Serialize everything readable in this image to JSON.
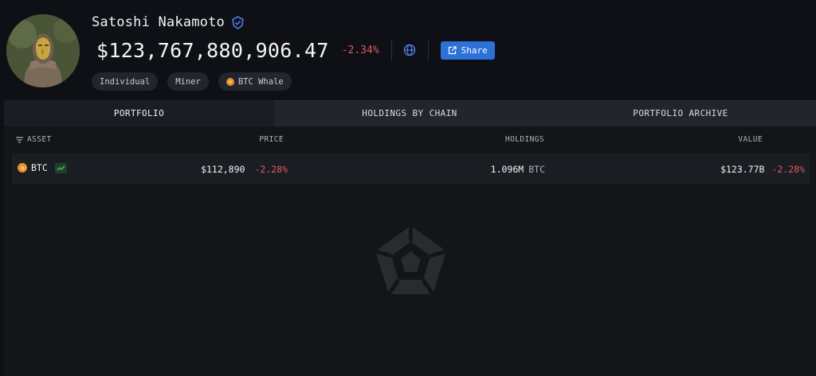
{
  "profile": {
    "name": "Satoshi Nakamoto",
    "total_value": "$123,767,880,906.47",
    "total_change": "-2.34%",
    "share_label": "Share",
    "tags": [
      {
        "label": "Individual"
      },
      {
        "label": "Miner"
      },
      {
        "label": "BTC Whale",
        "icon": "btc-coin-icon"
      }
    ]
  },
  "tabs": [
    {
      "label": "PORTFOLIO",
      "active": true
    },
    {
      "label": "HOLDINGS BY CHAIN",
      "active": false
    },
    {
      "label": "PORTFOLIO ARCHIVE",
      "active": false
    }
  ],
  "table": {
    "headers": {
      "asset": "ASSET",
      "price": "PRICE",
      "holdings": "HOLDINGS",
      "value": "VALUE"
    },
    "rows": [
      {
        "asset": "BTC",
        "price": "$112,890",
        "price_change": "-2.28%",
        "holdings": "1.096M",
        "holdings_unit": "BTC",
        "value": "$123.77B",
        "value_change": "-2.28%"
      }
    ]
  },
  "colors": {
    "accent": "#2c71d6",
    "negative": "#e05b5b",
    "background": "#0e1016",
    "btc": "#e8902a"
  }
}
